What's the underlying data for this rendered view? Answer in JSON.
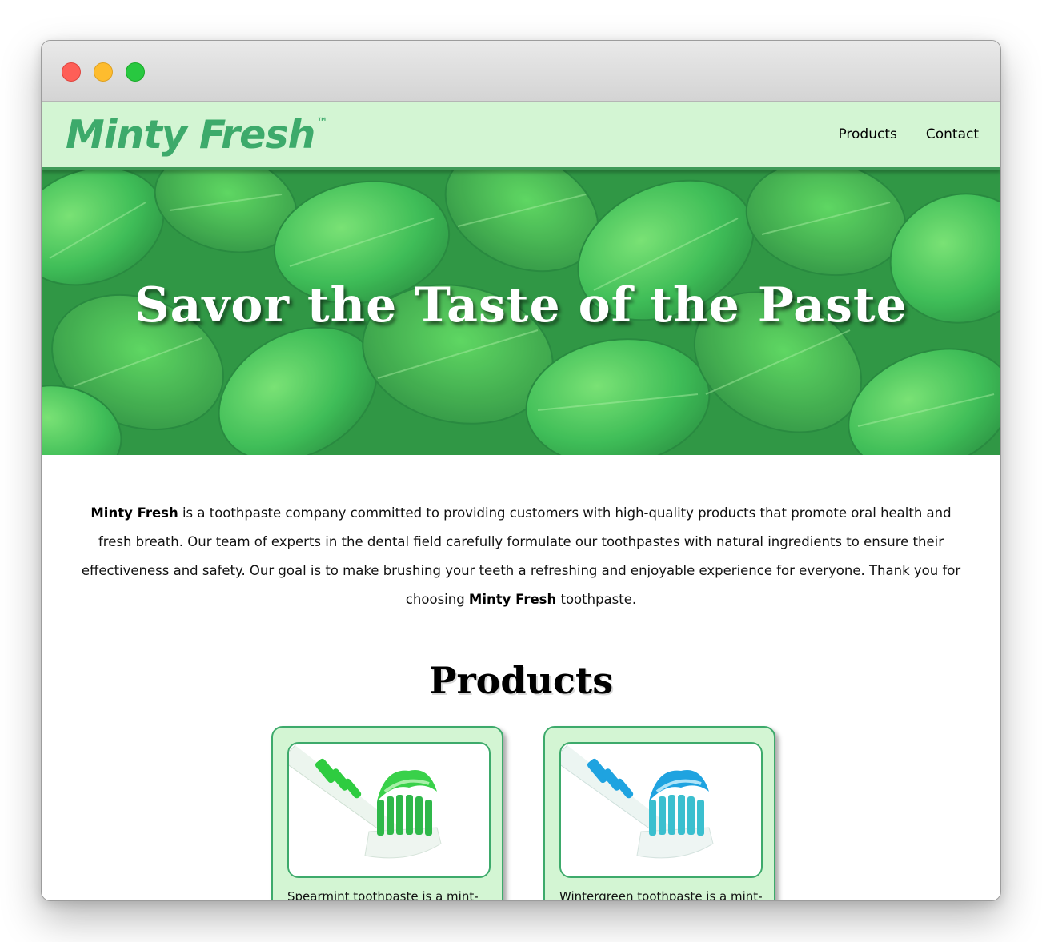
{
  "window": {
    "controls": [
      "close",
      "minimize",
      "zoom"
    ]
  },
  "header": {
    "logo": "Minty Fresh",
    "trademark": "™",
    "nav": [
      "Products",
      "Contact"
    ]
  },
  "hero": {
    "title": "Savor the Taste of the Paste"
  },
  "about": {
    "brand": "Minty Fresh",
    "text_1": " is a toothpaste company committed to providing customers with high-quality products that promote oral health and fresh breath. Our team of experts in the dental field carefully formulate our toothpastes with natural ingredients to ensure their effectiveness and safety. Our goal is to make brushing your teeth a refreshing and enjoyable experience for everyone. Thank you for choosing ",
    "brand_2": "Minty Fresh",
    "text_2": " toothpaste."
  },
  "products": {
    "heading": "Products",
    "items": [
      {
        "description": "Spearmint toothpaste is a mint-",
        "color": "#2ecc40",
        "icon": "green-toothpaste-icon"
      },
      {
        "description": "Wintergreen toothpaste is a mint-",
        "color": "#1fa3e0",
        "icon": "blue-toothpaste-icon"
      }
    ]
  },
  "colors": {
    "header_bg": "#d3f5d3",
    "brand_green": "#3daa6b",
    "header_border": "#3f9b58"
  }
}
